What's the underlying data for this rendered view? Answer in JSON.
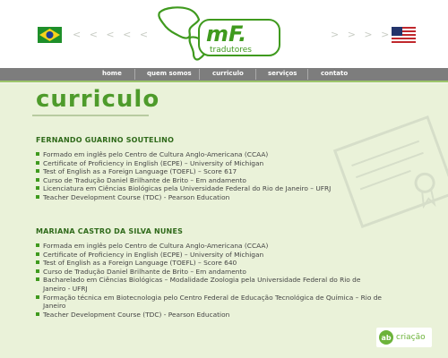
{
  "header": {
    "logo_text": "mF.",
    "logo_sub": "tradutores",
    "arrows_left": "< < < < <",
    "arrows_right": "> > > > >"
  },
  "nav": {
    "items": [
      "home",
      "quem somos",
      "curriculo",
      "serviços",
      "contato"
    ]
  },
  "page": {
    "title": "curriculo"
  },
  "people": [
    {
      "name": "FERNANDO GUARINO SOUTELINO",
      "items": [
        "Formado em inglês pelo Centro de Cultura Anglo-Americana (CCAA)",
        "Certificate of Proficiency in English (ECPE) – University of Michigan",
        "Test of English as a Foreign Language (TOEFL) – Score 617",
        "Curso de Tradução Daniel Brilhante de Brito – Em andamento",
        "Licenciatura em Ciências Biológicas pela Universidade Federal do Rio de Janeiro – UFRJ",
        "Teacher Development Course (TDC) - Pearson Education"
      ]
    },
    {
      "name": "MARIANA CASTRO DA SILVA NUNES",
      "items": [
        "Formada em inglês pelo Centro de Cultura Anglo-Americana (CCAA)",
        "Certificate of Proficiency in English (ECPE) – University of Michigan",
        "Test of English as a Foreign Language (TOEFL) – Score 640",
        "Curso de Tradução Daniel Brilhante de Brito – Em andamento",
        "Bacharelado em Ciências Biológicas – Modalidade Zoologia pela Universidade Federal do Rio de Janeiro - UFRJ",
        "Formação técnica em Biotecnologia pelo Centro Federal de Educação Tecnológica de Química – Rio de Janeiro",
        "Teacher Development Course (TDC) - Pearson Education"
      ]
    }
  ],
  "footer": {
    "badge_mark": "ab",
    "badge_text": "criação"
  },
  "colors": {
    "accent_green": "#4e9b2b",
    "nav_gray": "#7d7d7d",
    "content_bg": "#eaf2d9"
  }
}
